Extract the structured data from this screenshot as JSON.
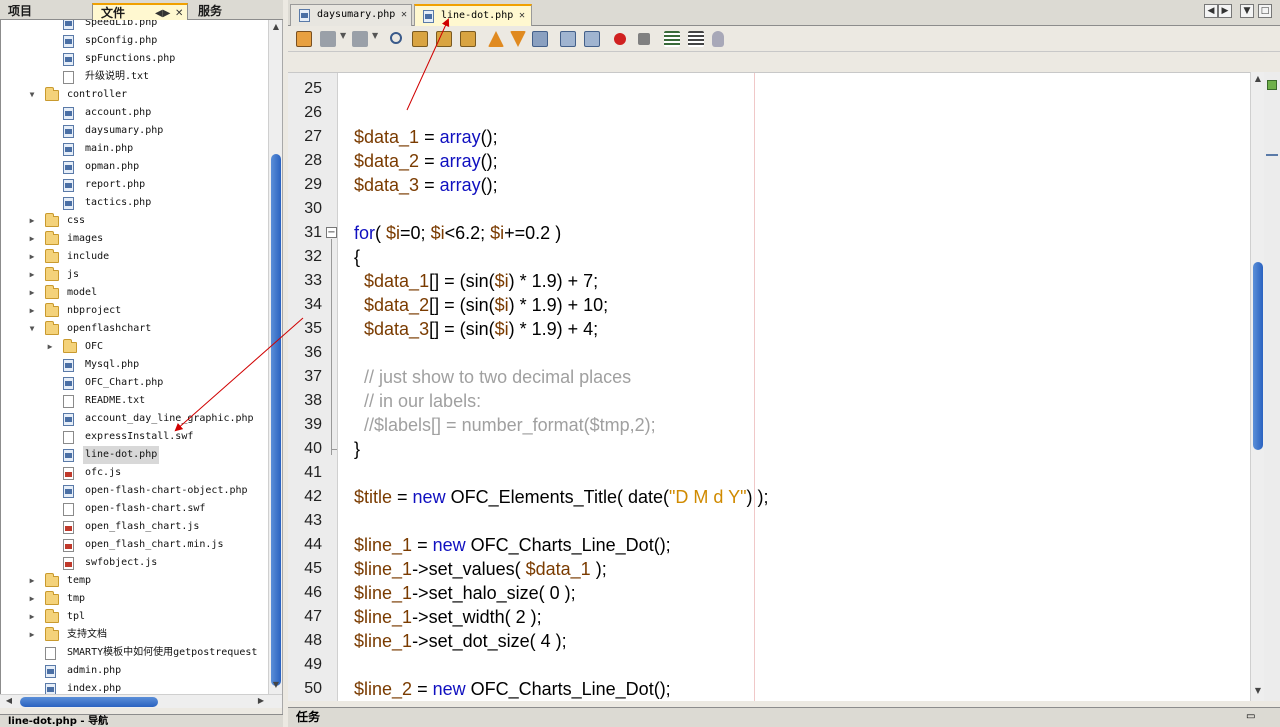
{
  "left_tabs": {
    "project": "项目",
    "files": "文件",
    "services": "服务",
    "files_ctrl": "◀▶",
    "close": "✕"
  },
  "tree": [
    {
      "label": "SpeedLib.php",
      "icon": "php",
      "indent": 3,
      "toggle": ""
    },
    {
      "label": "spConfig.php",
      "icon": "php",
      "indent": 3,
      "toggle": ""
    },
    {
      "label": "spFunctions.php",
      "icon": "php",
      "indent": 3,
      "toggle": ""
    },
    {
      "label": "升级说明.txt",
      "icon": "txt",
      "indent": 3,
      "toggle": ""
    },
    {
      "label": "controller",
      "icon": "folder",
      "indent": 2,
      "toggle": "▼"
    },
    {
      "label": "account.php",
      "icon": "php",
      "indent": 3,
      "toggle": ""
    },
    {
      "label": "daysumary.php",
      "icon": "php",
      "indent": 3,
      "toggle": ""
    },
    {
      "label": "main.php",
      "icon": "php",
      "indent": 3,
      "toggle": ""
    },
    {
      "label": "opman.php",
      "icon": "php",
      "indent": 3,
      "toggle": ""
    },
    {
      "label": "report.php",
      "icon": "php",
      "indent": 3,
      "toggle": ""
    },
    {
      "label": "tactics.php",
      "icon": "php",
      "indent": 3,
      "toggle": ""
    },
    {
      "label": "css",
      "icon": "folder",
      "indent": 2,
      "toggle": "▶"
    },
    {
      "label": "images",
      "icon": "folder",
      "indent": 2,
      "toggle": "▶"
    },
    {
      "label": "include",
      "icon": "folder",
      "indent": 2,
      "toggle": "▶"
    },
    {
      "label": "js",
      "icon": "folder",
      "indent": 2,
      "toggle": "▶"
    },
    {
      "label": "model",
      "icon": "folder",
      "indent": 2,
      "toggle": "▶"
    },
    {
      "label": "nbproject",
      "icon": "folder",
      "indent": 2,
      "toggle": "▶"
    },
    {
      "label": "openflashchart",
      "icon": "folder",
      "indent": 2,
      "toggle": "▼"
    },
    {
      "label": "OFC",
      "icon": "folder",
      "indent": 3,
      "toggle": "▶"
    },
    {
      "label": "Mysql.php",
      "icon": "php",
      "indent": 3,
      "toggle": ""
    },
    {
      "label": "OFC_Chart.php",
      "icon": "php",
      "indent": 3,
      "toggle": ""
    },
    {
      "label": "README.txt",
      "icon": "txt",
      "indent": 3,
      "toggle": ""
    },
    {
      "label": "account_day_line_graphic.php",
      "icon": "php",
      "indent": 3,
      "toggle": ""
    },
    {
      "label": "expressInstall.swf",
      "icon": "txt",
      "indent": 3,
      "toggle": ""
    },
    {
      "label": "line-dot.php",
      "icon": "php",
      "indent": 3,
      "toggle": "",
      "selected": true
    },
    {
      "label": "ofc.js",
      "icon": "js",
      "indent": 3,
      "toggle": ""
    },
    {
      "label": "open-flash-chart-object.php",
      "icon": "php",
      "indent": 3,
      "toggle": ""
    },
    {
      "label": "open-flash-chart.swf",
      "icon": "txt",
      "indent": 3,
      "toggle": ""
    },
    {
      "label": "open_flash_chart.js",
      "icon": "js",
      "indent": 3,
      "toggle": ""
    },
    {
      "label": "open_flash_chart.min.js",
      "icon": "js",
      "indent": 3,
      "toggle": ""
    },
    {
      "label": "swfobject.js",
      "icon": "js",
      "indent": 3,
      "toggle": ""
    },
    {
      "label": "temp",
      "icon": "folder",
      "indent": 2,
      "toggle": "▶"
    },
    {
      "label": "tmp",
      "icon": "folder",
      "indent": 2,
      "toggle": "▶"
    },
    {
      "label": "tpl",
      "icon": "folder",
      "indent": 2,
      "toggle": "▶"
    },
    {
      "label": "支持文档",
      "icon": "folder",
      "indent": 2,
      "toggle": "▶"
    },
    {
      "label": "SMARTY模板中如何使用getpostrequest",
      "icon": "txt",
      "indent": 2,
      "toggle": ""
    },
    {
      "label": "admin.php",
      "icon": "php",
      "indent": 2,
      "toggle": ""
    },
    {
      "label": "index.php",
      "icon": "php",
      "indent": 2,
      "toggle": ""
    }
  ],
  "navigator": {
    "title": "line-dot.php - 导航"
  },
  "editor_tabs": [
    {
      "label": "daysumary.php",
      "close": "✕",
      "active": false
    },
    {
      "label": "line-dot.php",
      "close": "✕",
      "active": true
    }
  ],
  "window_buttons": [
    "◀",
    "▶",
    "▼",
    "□"
  ],
  "code_lines": [
    {
      "n": "25",
      "html": ""
    },
    {
      "n": "26",
      "html": ""
    },
    {
      "n": "27",
      "html": "<span class='v'>$data_1</span> = <span class='k'>array</span>();"
    },
    {
      "n": "28",
      "html": "<span class='v'>$data_2</span> = <span class='k'>array</span>();"
    },
    {
      "n": "29",
      "html": "<span class='v'>$data_3</span> = <span class='k'>array</span>();"
    },
    {
      "n": "30",
      "html": ""
    },
    {
      "n": "31",
      "html": "<span class='k'>for</span>( <span class='v'>$i</span>=0; <span class='v'>$i</span>&lt;6.2; <span class='v'>$i</span>+=0.2 )",
      "fold": "−"
    },
    {
      "n": "32",
      "html": "{"
    },
    {
      "n": "33",
      "html": "  <span class='v'>$data_1</span>[] = (sin(<span class='v'>$i</span>) * 1.9) + 7;"
    },
    {
      "n": "34",
      "html": "  <span class='v'>$data_2</span>[] = (sin(<span class='v'>$i</span>) * 1.9) + 10;"
    },
    {
      "n": "35",
      "html": "  <span class='v'>$data_3</span>[] = (sin(<span class='v'>$i</span>) * 1.9) + 4;"
    },
    {
      "n": "36",
      "html": ""
    },
    {
      "n": "37",
      "html": "  <span class='c'>// just show to two decimal places</span>"
    },
    {
      "n": "38",
      "html": "  <span class='c'>// in our labels:</span>"
    },
    {
      "n": "39",
      "html": "  <span class='c'>//$labels[] = number_format($tmp,2);</span>"
    },
    {
      "n": "40",
      "html": "}"
    },
    {
      "n": "41",
      "html": ""
    },
    {
      "n": "42",
      "html": "<span class='v'>$title</span> = <span class='k'>new</span> OFC_Elements_Title( date(<span class='s'>\"D M d Y\"</span>) );"
    },
    {
      "n": "43",
      "html": ""
    },
    {
      "n": "44",
      "html": "<span class='v'>$line_1</span> = <span class='k'>new</span> OFC_Charts_Line_Dot();"
    },
    {
      "n": "45",
      "html": "<span class='v'>$line_1</span>-&gt;set_values( <span class='v'>$data_1</span> );"
    },
    {
      "n": "46",
      "html": "<span class='v'>$line_1</span>-&gt;set_halo_size( 0 );"
    },
    {
      "n": "47",
      "html": "<span class='v'>$line_1</span>-&gt;set_width( 2 );"
    },
    {
      "n": "48",
      "html": "<span class='v'>$line_1</span>-&gt;set_dot_size( 4 );"
    },
    {
      "n": "49",
      "html": ""
    },
    {
      "n": "50",
      "html": "<span class='v'>$line_2</span> = <span class='k'>new</span> OFC_Charts_Line_Dot();"
    }
  ],
  "bottom_panel": {
    "title": "任务"
  },
  "colors": {
    "accent": "#f0a000",
    "selection": "#d8d8d8",
    "scroll_thumb": "#2a62c0",
    "annotation_arrow": "#d00000"
  }
}
